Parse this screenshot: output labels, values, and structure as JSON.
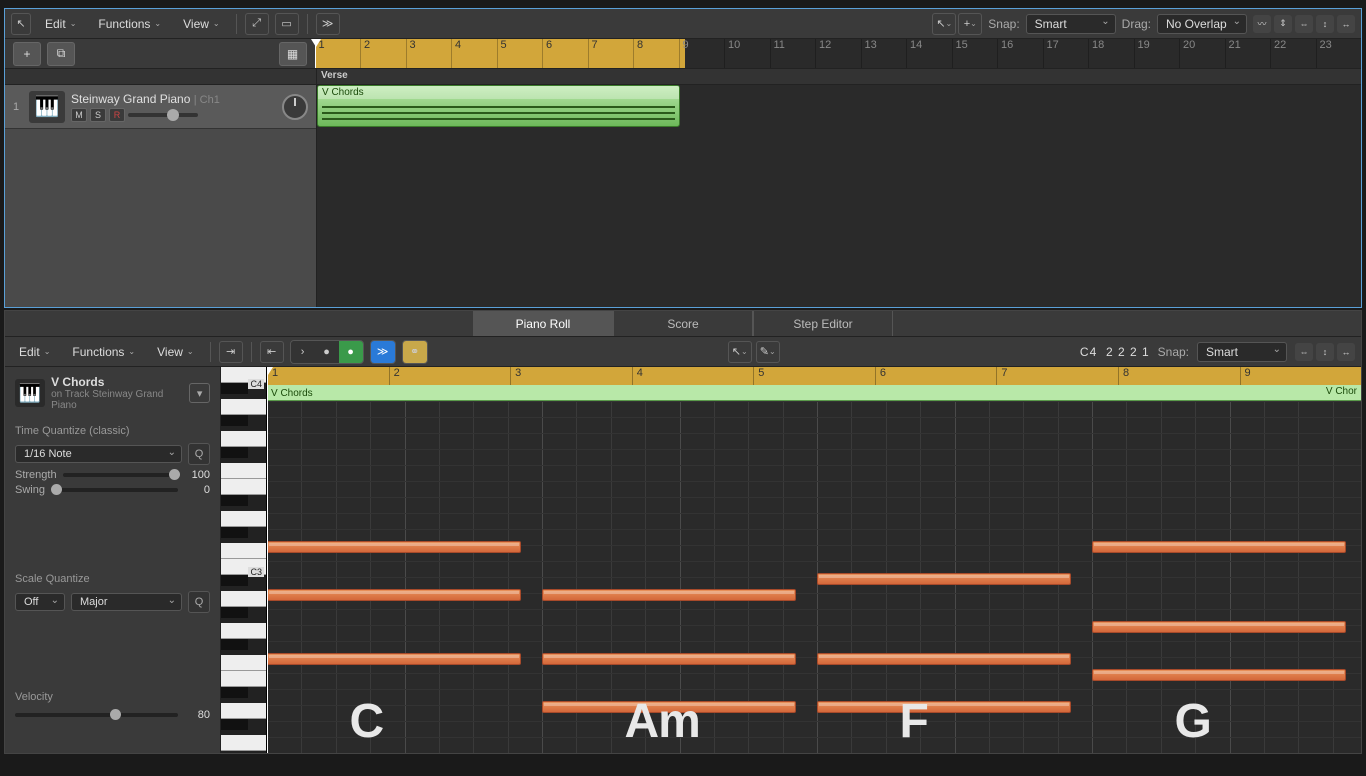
{
  "arrange": {
    "menus": {
      "edit": "Edit",
      "functions": "Functions",
      "view": "View"
    },
    "snap_label": "Snap:",
    "snap_value": "Smart",
    "drag_label": "Drag:",
    "drag_value": "No Overlap",
    "ruler_bars": [
      "1",
      "2",
      "3",
      "4",
      "5",
      "6",
      "7",
      "8",
      "9",
      "10",
      "11",
      "12",
      "13",
      "14",
      "15",
      "16",
      "17",
      "18",
      "19",
      "20",
      "21",
      "22",
      "23"
    ],
    "marker": "Verse",
    "track": {
      "number": "1",
      "name": "Steinway Grand Piano",
      "channel": "Ch1",
      "mute": "M",
      "solo": "S",
      "rec": "R"
    },
    "region_name": "V Chords"
  },
  "editor": {
    "tabs": {
      "piano_roll": "Piano Roll",
      "score": "Score",
      "step": "Step Editor"
    },
    "menus": {
      "edit": "Edit",
      "functions": "Functions",
      "view": "View"
    },
    "note_display": "C4",
    "time_display": "2 2 2 1",
    "snap_label": "Snap:",
    "snap_value": "Smart",
    "inspector": {
      "region_name": "V Chords",
      "track_label": "on Track Steinway Grand Piano",
      "time_q_label": "Time Quantize (classic)",
      "time_q_value": "1/16 Note",
      "strength_label": "Strength",
      "strength_value": "100",
      "swing_label": "Swing",
      "swing_value": "0",
      "scale_q_label": "Scale Quantize",
      "scale_off": "Off",
      "scale_major": "Major",
      "velocity_label": "Velocity",
      "velocity_value": "80",
      "q_btn": "Q"
    },
    "ruler_bars": [
      "1",
      "2",
      "3",
      "4",
      "5",
      "6",
      "7",
      "8",
      "9"
    ],
    "strip_name": "V Chords",
    "strip_name2": "V Chor",
    "key_labels": {
      "c4": "C4",
      "c3": "C3"
    },
    "chords": [
      "C",
      "Am",
      "F",
      "G"
    ],
    "notes": [
      {
        "bar": 0,
        "len": 1.85,
        "row": 5
      },
      {
        "bar": 0,
        "len": 1.85,
        "row": 8
      },
      {
        "bar": 0,
        "len": 1.85,
        "row": 12
      },
      {
        "bar": 2,
        "len": 1.85,
        "row": 8
      },
      {
        "bar": 2,
        "len": 1.85,
        "row": 12
      },
      {
        "bar": 2,
        "len": 1.85,
        "row": 15
      },
      {
        "bar": 4,
        "len": 1.85,
        "row": 7
      },
      {
        "bar": 4,
        "len": 1.85,
        "row": 12
      },
      {
        "bar": 4,
        "len": 1.85,
        "row": 15
      },
      {
        "bar": 6,
        "len": 1.85,
        "row": 5
      },
      {
        "bar": 6,
        "len": 1.85,
        "row": 10
      },
      {
        "bar": 6,
        "len": 1.85,
        "row": 13
      }
    ]
  }
}
